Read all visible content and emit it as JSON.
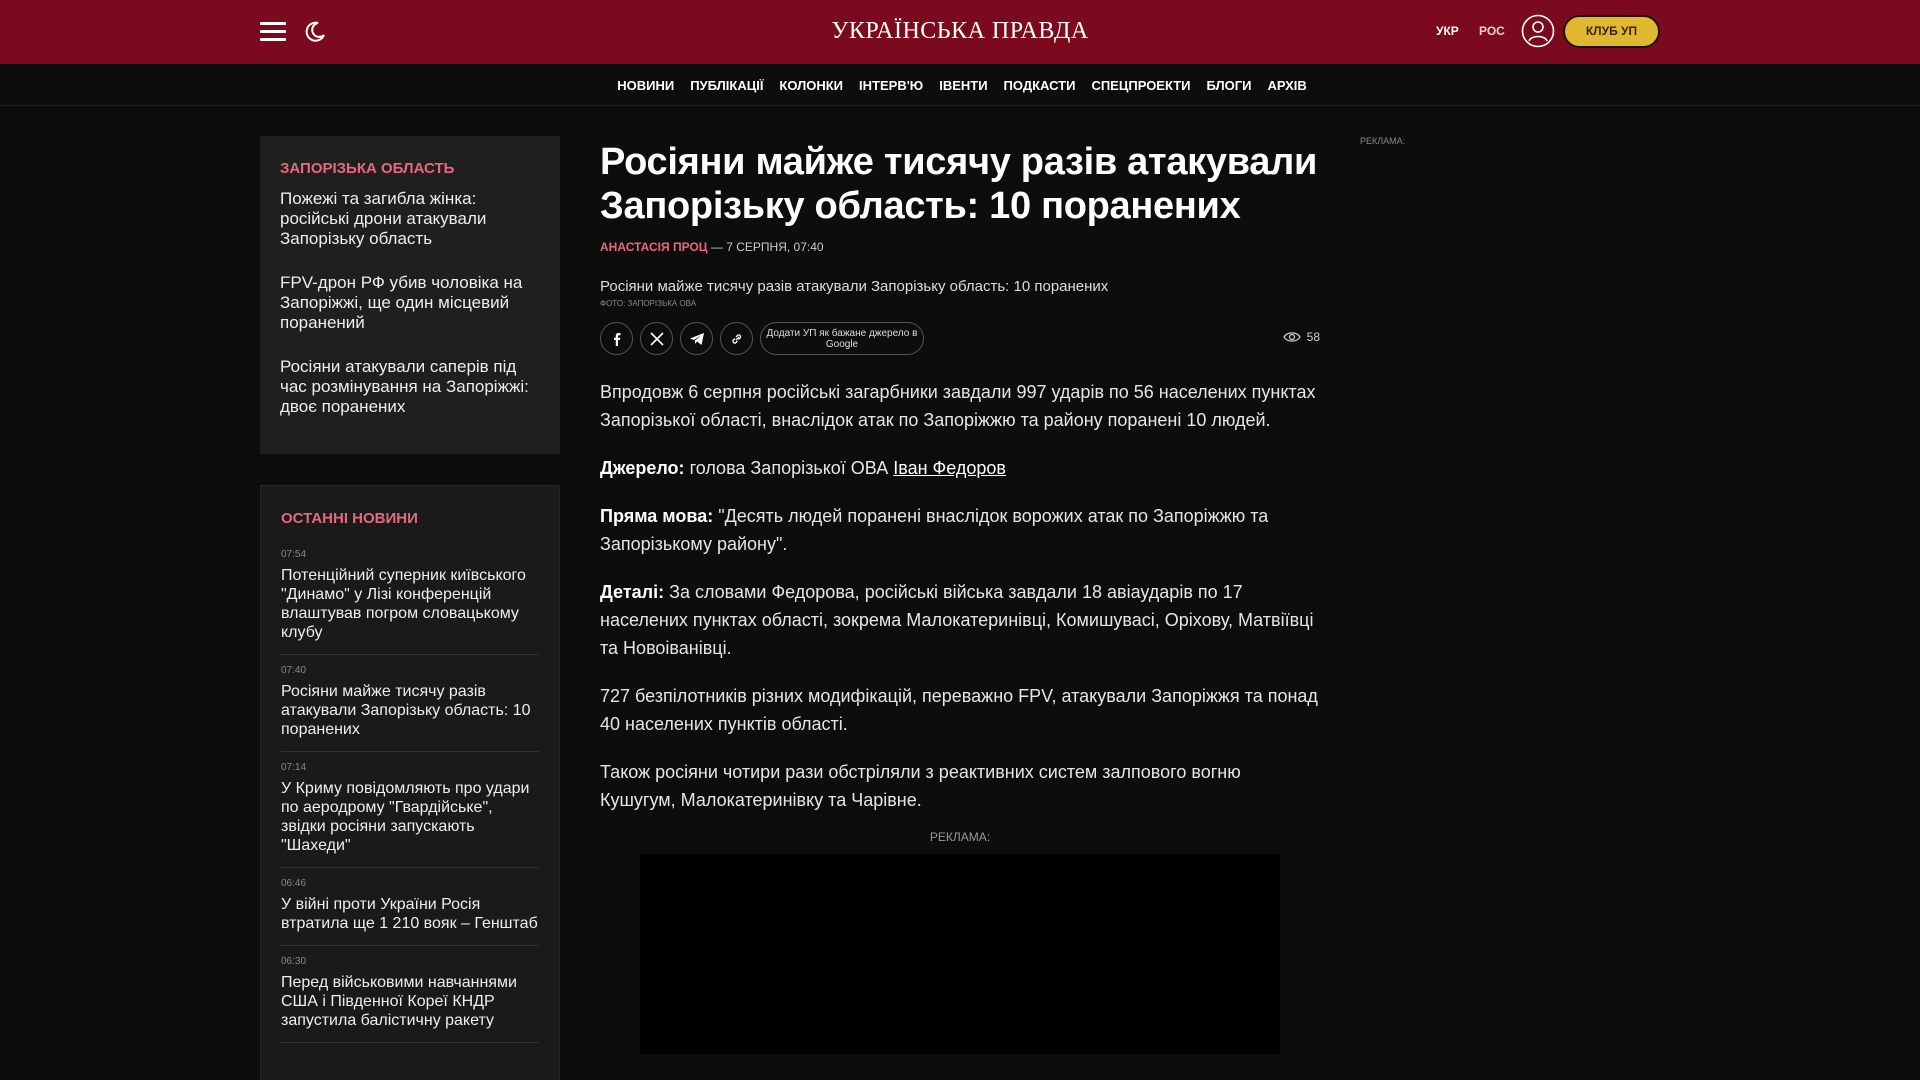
{
  "header": {
    "logo": "УКРАЇНСЬКА ПРАВДА",
    "lang_ukr": "УКР",
    "lang_ros": "РОС",
    "club_label": "КЛУБ УП",
    "brand_color": "#7c0a1e",
    "accent_color": "#e0b830"
  },
  "nav": {
    "items": [
      "НОВИНИ",
      "ПУБЛІКАЦІЇ",
      "КОЛОНКИ",
      "ІНТЕРВ'Ю",
      "ІВЕНТИ",
      "ПОДКАСТИ",
      "СПЕЦПРОЕКТИ",
      "БЛОГИ",
      "АРХІВ"
    ]
  },
  "related": {
    "title": "ЗАПОРІЗЬКА ОБЛАСТЬ",
    "items": [
      "Пожежі та загибла жінка: російські дрони атакували Запорізьку область",
      "FPV-дрон РФ убив чоловіка на Запоріжжі, ще один місцевий поранений",
      "Росіяни атакували саперів під час розмінування на Запоріжжі: двоє поранених"
    ]
  },
  "latest": {
    "title": "ОСТАННІ НОВИНИ",
    "items": [
      {
        "time": "07:54",
        "title": "Потенційний суперник київського \"Динамо\" у Лізі конференцій влаштував погром словацькому клубу"
      },
      {
        "time": "07:40",
        "title": "Росіяни майже тисячу разів атакували Запорізьку область: 10 поранених"
      },
      {
        "time": "07:14",
        "title": "У Криму повідомляють про удари по аеродрому \"Гвардійське\", звідки росіяни запускають \"Шахеди\""
      },
      {
        "time": "06:46",
        "title": "У війні проти України Росія втратила ще 1 210 вояк – Генштаб"
      },
      {
        "time": "06:30",
        "title": "Перед військовими навчаннями США і Південної Кореї КНДР запустила балістичну ракету"
      }
    ]
  },
  "article": {
    "headline": "Росіяни майже тисячу разів атакували Запорізьку область: 10 поранених",
    "author": "АНАСТАСІЯ ПРОЦ",
    "date": " — 7 СЕРПНЯ, 07:40",
    "photo_alt": "Росіяни майже тисячу разів атакували Запорізьку область: 10 поранених",
    "photo_credit": "Фото: Запорізька ОВА",
    "google_btn": "Додати УП як бажане джерело в Google",
    "views": "58",
    "p1": "Впродовж 6 серпня російські загарбники завдали 997 ударів по 56 населених пунктах Запорізької області, внаслідок атак по Запоріжжю та району поранені 10 людей.",
    "p2_label": "Джерело:",
    "p2_text": " голова Запорізької ОВА ",
    "p2_link": "Іван Федоров",
    "p3_label": "Пряма мова:",
    "p3_text": " \"Десять людей поранені внаслідок ворожих атак по Запоріжжю та Запорізькому району\".",
    "p4_label": "Деталі:",
    "p4_text": " За словами Федорова, російські війська завдали 18 авіаударів по 17 населених пунктах області, зокрема Малокатеринівці, Комишувасі, Оріхову, Матвіївці та Новоіванівці.",
    "p5": "727 безпілотників різних модифікацій, переважно FPV, атакували Запоріжжя та понад 40 населених пунктів області.",
    "p6": "Також росіяни чотири рази обстріляли з реактивних систем залпового вогню Кушугум, Малокатеринівку та Чарівне.",
    "ad_label": "РЕКЛАМА:"
  },
  "right_ad_label": "РЕКЛАМА:"
}
